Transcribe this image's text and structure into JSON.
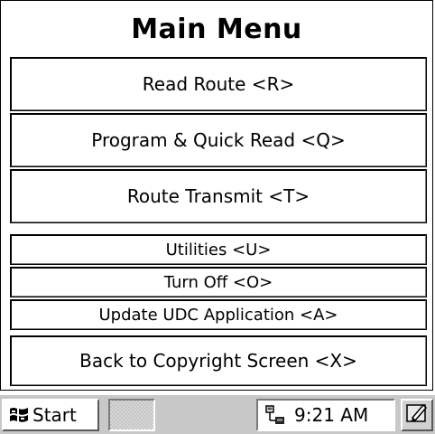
{
  "window": {
    "title": "Main Menu"
  },
  "menu": {
    "read_route": "Read Route <R>",
    "program_quick_read": "Program & Quick Read <Q>",
    "route_transmit": "Route Transmit <T>",
    "utilities": "Utilities <U>",
    "turn_off": "Turn Off <O>",
    "update_udc": "Update UDC Application <A>",
    "back_copyright": "Back to Copyright Screen <X>"
  },
  "taskbar": {
    "start_label": "Start",
    "start_icon": "windows-flag-icon",
    "network_icon": "network-connection-icon",
    "clock": "9:21 AM",
    "sip_icon": "input-panel-pen-icon"
  }
}
